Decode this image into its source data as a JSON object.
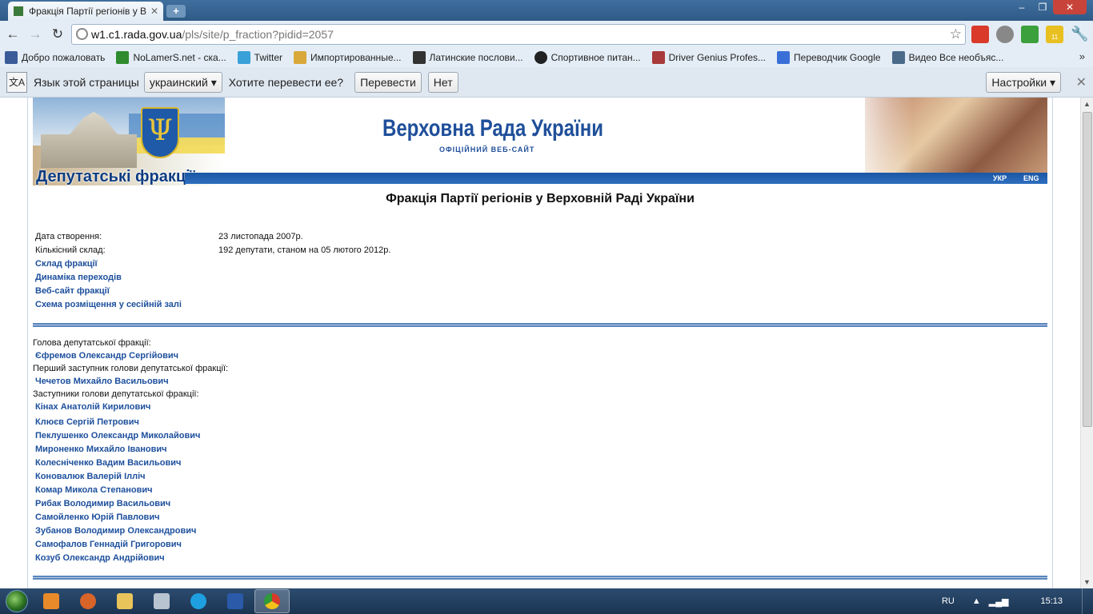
{
  "browser": {
    "tab_title": "Фракція Партії регіонів у В",
    "url_host": "w1.c1.rada.gov.ua",
    "url_path": "/pls/site/p_fraction?pidid=2057",
    "bookmarks": [
      {
        "label": "Добро пожаловать",
        "color": "#3b5b98"
      },
      {
        "label": "NoLamerS.net - ска...",
        "color": "#2e8b2e"
      },
      {
        "label": "Twitter",
        "color": "#3aa0d8"
      },
      {
        "label": "Импортированные...",
        "color": "#d9a83a"
      },
      {
        "label": "Латинские послови...",
        "color": "#333333"
      },
      {
        "label": "Спортивное питан...",
        "color": "#222222"
      },
      {
        "label": "Driver Genius Profes...",
        "color": "#a83a3a"
      },
      {
        "label": "Переводчик Google",
        "color": "#3a6fd8"
      },
      {
        "label": "Видео Все необъяс...",
        "color": "#4a6a8a"
      }
    ],
    "more_bookmarks": "»",
    "extension_badge": "11"
  },
  "translate_bar": {
    "prompt": "Язык этой страницы",
    "language": "украинский ▾",
    "question": "Хотите перевести ее?",
    "translate_button": "Перевести",
    "no_button": "Нет",
    "settings_button": "Настройки ▾"
  },
  "banner": {
    "section": "Депутатські фракції",
    "title": "Верховна Рада України",
    "subtitle": "ОФІЦІЙНИЙ ВЕБ-САЙТ",
    "lang_ukr": "УКР",
    "lang_eng": "ENG"
  },
  "page": {
    "title": "Фракція Партії регіонів у Верховній Раді України",
    "created_label": "Дата створення:",
    "created_value": "23 листопада 2007р.",
    "count_label": "Кількісний склад:",
    "count_value": "192 депутати, станом на 05 лютого 2012р.",
    "links": [
      "Склад фракції",
      "Динаміка переходів",
      "Веб-сайт фракції",
      "Схема розміщення у сесійній залі"
    ],
    "head_label": "Голова депутатської фракції:",
    "head_name": "Єфремов Олександр Сергійович",
    "first_deputy_label": "Перший заступник голови депутатської фракції:",
    "first_deputy_name": "Чечетов Михайло Васильович",
    "deputies_label": "Заступники голови депутатської фракції:",
    "deputies": [
      "Кінах Анатолій Кирилович",
      "Клюєв Сергій Петрович",
      "Пеклушенко Олександр Миколайович",
      "Мироненко Михайло Іванович",
      "Колесніченко Вадим Васильович",
      "Коновалюк Валерій Ілліч",
      "Комар Микола Степанович",
      "Рибак Володимир Васильович",
      "Самойленко Юрій Павлович",
      "Зубанов Володимир Олександрович",
      "Самофалов Геннадій Григорович",
      "Козуб Олександр Андрійович"
    ]
  },
  "taskbar": {
    "language": "RU",
    "clock": "15:13"
  }
}
